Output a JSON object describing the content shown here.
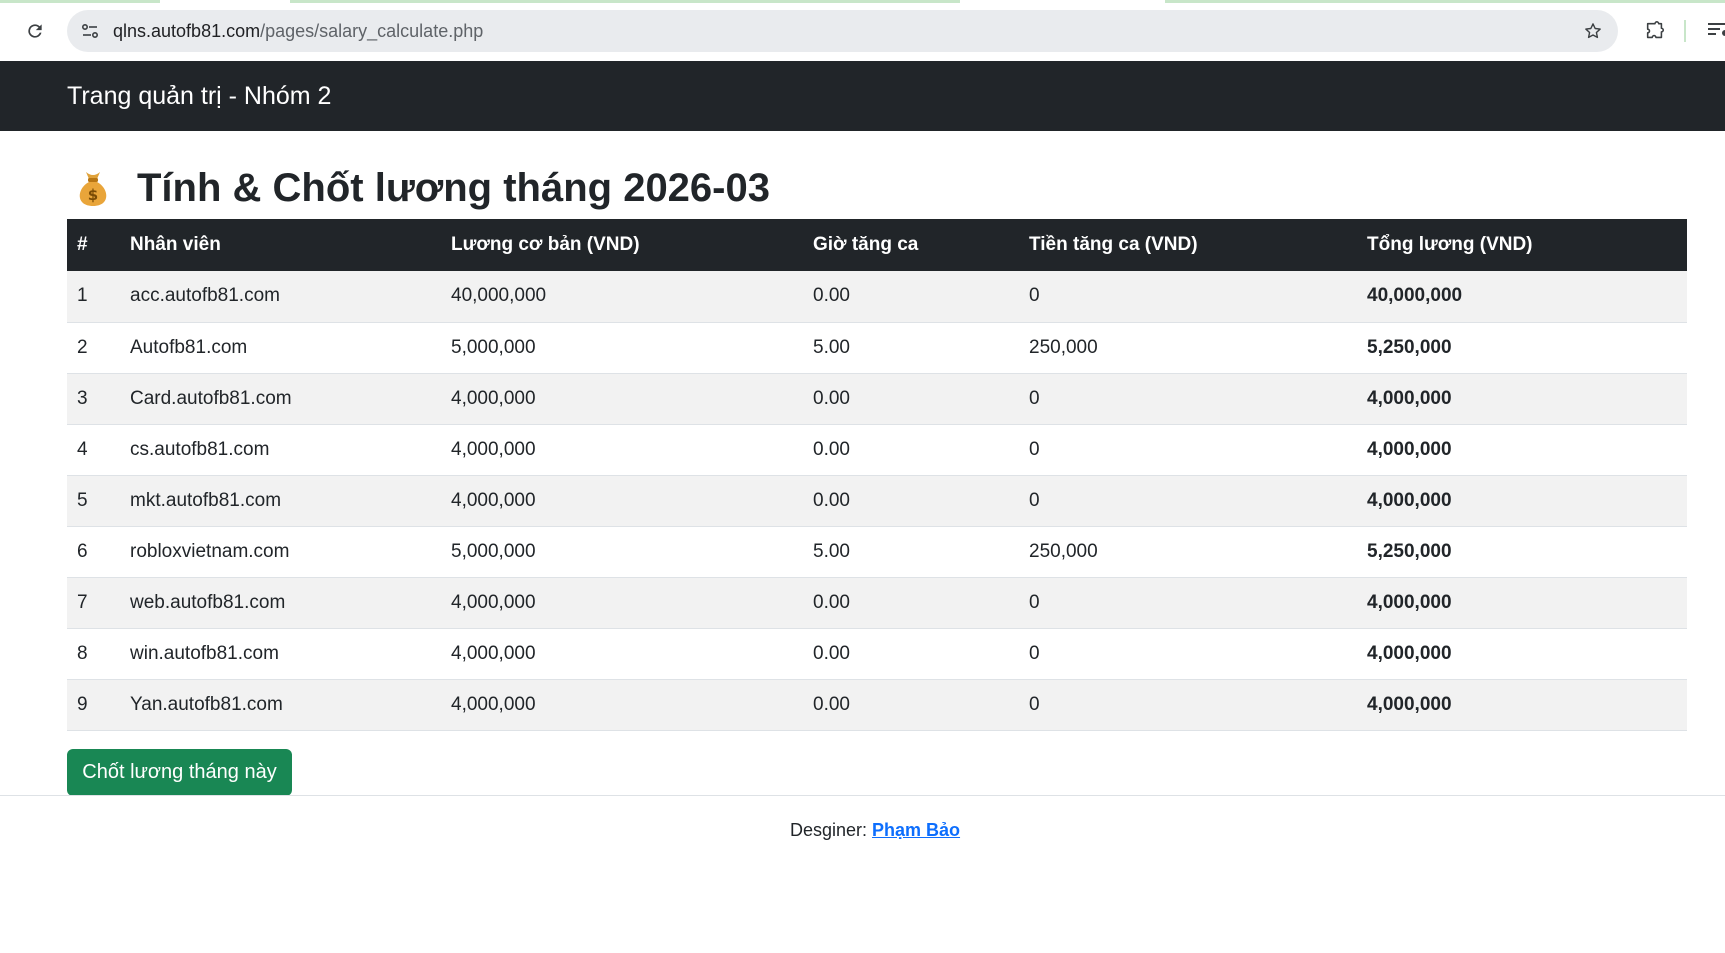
{
  "browser": {
    "url_host": "qlns.autofb81.com",
    "url_path": "/pages/salary_calculate.php"
  },
  "navbar": {
    "brand": "Trang quản trị - Nhóm 2"
  },
  "page": {
    "title": "Tính & Chốt lương tháng 2026-03",
    "title_icon": "money-bag-icon"
  },
  "table": {
    "headers": [
      "#",
      "Nhân viên",
      "Lương cơ bản (VND)",
      "Giờ tăng ca",
      "Tiền tăng ca (VND)",
      "Tổng lương (VND)"
    ],
    "rows": [
      {
        "no": "1",
        "employee": "acc.autofb81.com",
        "base": "40,000,000",
        "ot_hours": "0.00",
        "ot_pay": "0",
        "total": "40,000,000"
      },
      {
        "no": "2",
        "employee": "Autofb81.com",
        "base": "5,000,000",
        "ot_hours": "5.00",
        "ot_pay": "250,000",
        "total": "5,250,000"
      },
      {
        "no": "3",
        "employee": "Card.autofb81.com",
        "base": "4,000,000",
        "ot_hours": "0.00",
        "ot_pay": "0",
        "total": "4,000,000"
      },
      {
        "no": "4",
        "employee": "cs.autofb81.com",
        "base": "4,000,000",
        "ot_hours": "0.00",
        "ot_pay": "0",
        "total": "4,000,000"
      },
      {
        "no": "5",
        "employee": "mkt.autofb81.com",
        "base": "4,000,000",
        "ot_hours": "0.00",
        "ot_pay": "0",
        "total": "4,000,000"
      },
      {
        "no": "6",
        "employee": "robloxvietnam.com",
        "base": "5,000,000",
        "ot_hours": "5.00",
        "ot_pay": "250,000",
        "total": "5,250,000"
      },
      {
        "no": "7",
        "employee": "web.autofb81.com",
        "base": "4,000,000",
        "ot_hours": "0.00",
        "ot_pay": "0",
        "total": "4,000,000"
      },
      {
        "no": "8",
        "employee": "win.autofb81.com",
        "base": "4,000,000",
        "ot_hours": "0.00",
        "ot_pay": "0",
        "total": "4,000,000"
      },
      {
        "no": "9",
        "employee": "Yan.autofb81.com",
        "base": "4,000,000",
        "ot_hours": "0.00",
        "ot_pay": "0",
        "total": "4,000,000"
      }
    ]
  },
  "actions": {
    "close_salary_label": "Chốt lương tháng này"
  },
  "footer": {
    "designer_label": "Desginer:",
    "designer_name": "Phạm Bảo"
  },
  "colors": {
    "navbar_bg": "#212529",
    "button_green": "#198754",
    "link_blue": "#0d6efd",
    "stripe": "#f2f2f2"
  }
}
